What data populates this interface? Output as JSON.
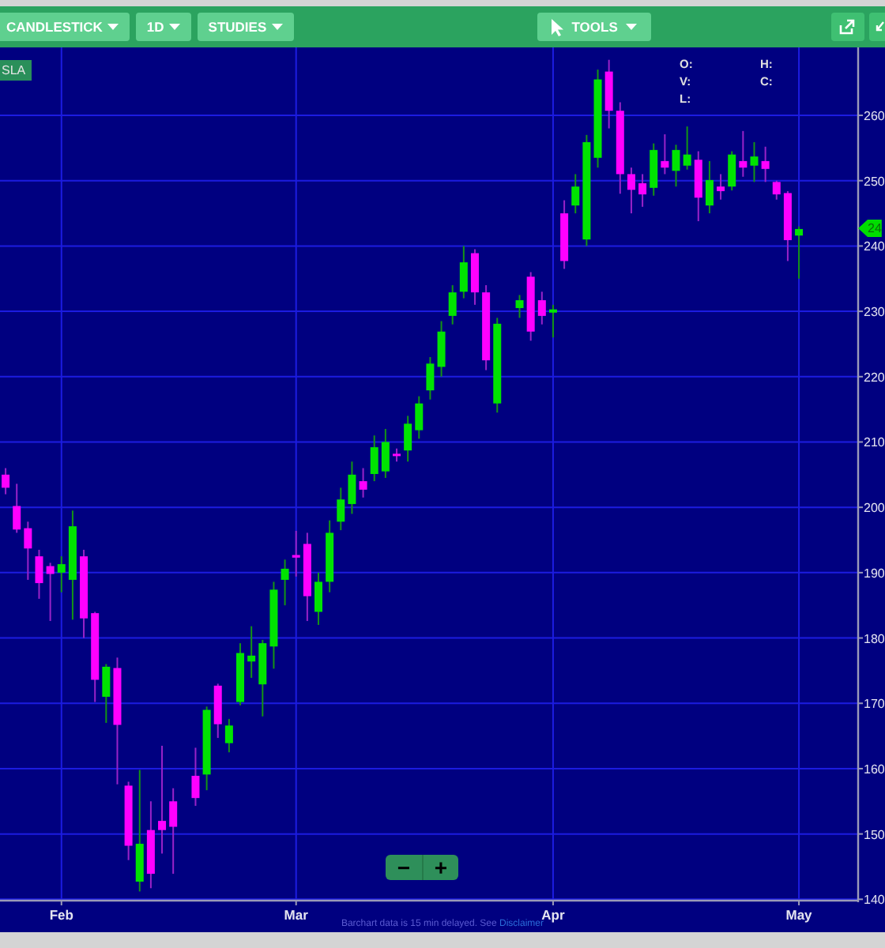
{
  "toolbar": {
    "buttons": [
      {
        "label": "CANDLESTICK",
        "kind": "dropdown"
      },
      {
        "label": "1D",
        "kind": "dropdown"
      },
      {
        "label": "STUDIES",
        "kind": "dropdown"
      }
    ],
    "tools": {
      "label": "TOOLS"
    }
  },
  "symbol": "SLA",
  "legend": [
    "O:",
    "H:",
    "V:",
    "C:",
    "L:"
  ],
  "price_tag": "24",
  "chart_data": {
    "type": "candlestick",
    "grid": true,
    "ylim": [
      139.8,
      270.4
    ],
    "yticks": [
      140,
      150,
      160,
      170,
      180,
      190,
      200,
      210,
      220,
      230,
      240,
      250,
      260
    ],
    "categories": [
      null,
      null,
      null,
      null,
      null,
      "Feb",
      null,
      null,
      null,
      null,
      null,
      null,
      null,
      null,
      null,
      null,
      null,
      null,
      null,
      null,
      null,
      null,
      null,
      null,
      null,
      null,
      "Mar",
      null,
      null,
      null,
      null,
      null,
      null,
      null,
      null,
      null,
      null,
      null,
      null,
      null,
      null,
      null,
      null,
      null,
      null,
      null,
      null,
      null,
      null,
      "Apr",
      null,
      null,
      null,
      null,
      null,
      null,
      null,
      null,
      null,
      null,
      null,
      null,
      null,
      null,
      null,
      null,
      null,
      null,
      null,
      null,
      null,
      "May"
    ],
    "ohlc": [
      [
        205,
        206,
        202,
        203
      ],
      [
        200.2,
        203.6,
        196.1,
        196.6
      ],
      [
        196.8,
        197.8,
        188.9,
        193.7
      ],
      [
        192.5,
        193.5,
        186,
        188.4
      ],
      [
        191,
        191.5,
        182.6,
        189.8
      ],
      [
        190,
        192.5,
        187,
        191.3
      ],
      [
        188.9,
        199.5,
        182.8,
        197.1
      ],
      [
        192.5,
        193.5,
        180,
        183
      ],
      [
        183.8,
        184,
        170.2,
        173.6
      ],
      [
        171,
        176,
        167,
        175.6
      ],
      [
        175.4,
        177,
        157.6,
        166.7
      ],
      [
        157.4,
        158,
        146,
        148.2
      ],
      [
        142.7,
        159.8,
        141.2,
        148.5
      ],
      [
        150.6,
        155,
        141.7,
        143.9
      ],
      [
        152,
        163.5,
        147,
        150.6
      ],
      [
        155,
        157,
        143.9,
        151.1
      ],
      null,
      [
        158.9,
        163.2,
        154.3,
        155.5
      ],
      [
        159.1,
        169.5,
        156.7,
        169
      ],
      [
        172.7,
        173,
        164.7,
        166.8
      ],
      [
        163.9,
        167.6,
        162.5,
        166.6
      ],
      [
        170.2,
        179.2,
        169.7,
        177.7
      ],
      [
        176.4,
        181.8,
        173.9,
        177.3
      ],
      [
        172.9,
        179.7,
        168,
        179.2
      ],
      [
        178.7,
        188.6,
        175.3,
        187.4
      ],
      [
        188.9,
        192,
        185,
        190.6
      ],
      [
        192.7,
        196.4,
        189.4,
        192.3
      ],
      [
        194.4,
        196.1,
        182.6,
        186.4
      ],
      [
        184,
        190,
        182,
        188.6
      ],
      [
        188.6,
        198,
        187,
        196.1
      ],
      [
        197.8,
        203,
        196.5,
        201.2
      ],
      [
        200.5,
        207,
        199,
        205
      ],
      [
        204,
        206,
        201.5,
        202.7
      ],
      [
        205.1,
        211,
        204,
        209.2
      ],
      [
        205.5,
        212,
        204.5,
        210
      ],
      [
        208.2,
        209,
        207,
        207.9
      ],
      [
        208.7,
        214,
        207,
        212.8
      ],
      [
        211.8,
        217,
        210.5,
        215.9
      ],
      [
        217.9,
        223,
        216.5,
        222
      ],
      [
        221.5,
        228.5,
        220,
        226.9
      ],
      [
        229.3,
        234,
        228,
        232.9
      ],
      [
        233,
        240,
        232,
        237.5
      ],
      [
        238.9,
        239.5,
        231,
        232.9
      ],
      [
        232.9,
        234,
        221,
        222.5
      ],
      [
        215.9,
        229,
        214.5,
        228.1
      ],
      null,
      [
        230.5,
        232.5,
        229,
        231.7
      ],
      [
        235.3,
        236,
        225.5,
        226.9
      ],
      [
        231.7,
        233,
        228,
        229.3
      ],
      [
        229.8,
        231,
        226,
        230.3
      ],
      [
        245,
        247,
        236.5,
        237.7
      ],
      [
        246.2,
        251,
        245,
        249.1
      ],
      [
        241,
        257,
        240,
        255.9
      ],
      [
        253.5,
        267,
        252,
        265.5
      ],
      [
        266.7,
        268.5,
        258,
        260.7
      ],
      [
        260.7,
        262,
        248,
        251
      ],
      [
        251,
        252,
        245,
        248.6
      ],
      [
        249.6,
        251,
        246,
        247.9
      ],
      [
        248.9,
        255.7,
        247.7,
        254.7
      ],
      [
        253,
        257.1,
        251,
        252
      ],
      [
        251.5,
        255.5,
        249.1,
        254.7
      ],
      [
        252.3,
        258.3,
        251.7,
        254
      ],
      [
        253.2,
        254.5,
        243.8,
        247.4
      ],
      [
        246.2,
        253,
        245,
        250.1
      ],
      [
        249.1,
        251,
        247.1,
        248.4
      ],
      [
        249.1,
        254.5,
        248.5,
        254
      ],
      [
        253,
        257.6,
        250.6,
        252
      ],
      [
        252.3,
        255.9,
        249.8,
        253.7
      ],
      [
        253,
        255.2,
        249.8,
        251.8
      ],
      [
        249.8,
        250,
        247.1,
        247.9
      ],
      [
        248.1,
        248.4,
        237.7,
        240.9
      ],
      [
        241.6,
        243,
        235,
        242.6
      ]
    ]
  },
  "zoom": {
    "minus": "−",
    "plus": "+"
  },
  "footer": {
    "text": "Barchart data is 15 min delayed. See",
    "link": "Disclaimer"
  }
}
